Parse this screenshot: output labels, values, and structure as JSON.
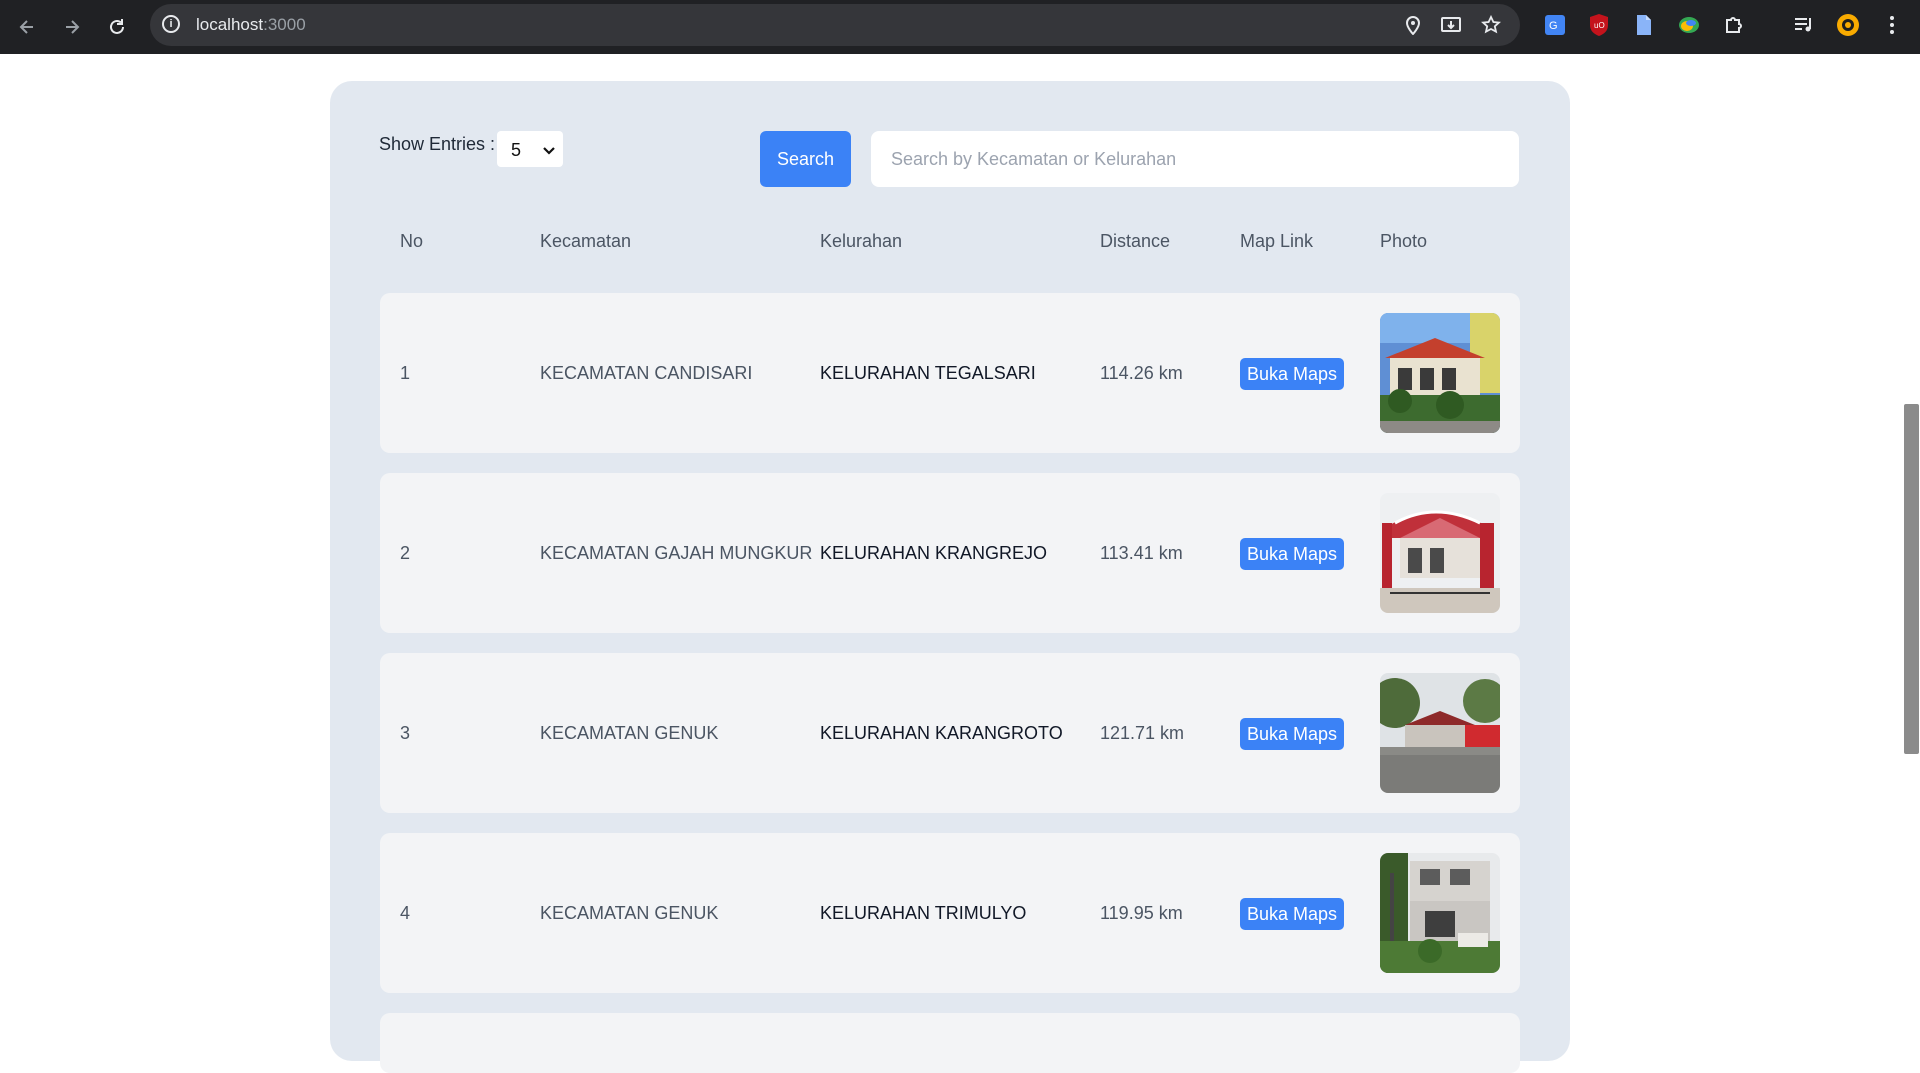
{
  "browser": {
    "url_host": "localhost",
    "url_port": ":3000"
  },
  "controls": {
    "entries_label": "Show Entries :",
    "entries_value": "5",
    "search_button": "Search",
    "search_placeholder": "Search by Kecamatan or Kelurahan"
  },
  "table": {
    "headers": [
      "No",
      "Kecamatan",
      "Kelurahan",
      "Distance",
      "Map Link",
      "Photo"
    ],
    "rows": [
      {
        "no": "1",
        "kecamatan": "KECAMATAN CANDISARI",
        "kelurahan": "KELURAHAN TEGALSARI",
        "distance": "114.26 km",
        "map_link": "Buka Maps",
        "photo": "office-photo-1"
      },
      {
        "no": "2",
        "kecamatan": "KECAMATAN GAJAH MUNGKUR",
        "kelurahan": "KELURAHAN KRANGREJO",
        "distance": "113.41 km",
        "map_link": "Buka Maps",
        "photo": "office-photo-2"
      },
      {
        "no": "3",
        "kecamatan": "KECAMATAN GENUK",
        "kelurahan": "KELURAHAN KARANGROTO",
        "distance": "121.71 km",
        "map_link": "Buka Maps",
        "photo": "office-photo-3"
      },
      {
        "no": "4",
        "kecamatan": "KECAMATAN GENUK",
        "kelurahan": "KELURAHAN TRIMULYO",
        "distance": "119.95 km",
        "map_link": "Buka Maps",
        "photo": "office-photo-4"
      }
    ]
  },
  "colors": {
    "accent": "#3b82f6",
    "panel": "#e2e8f0",
    "row": "#f3f4f6"
  }
}
